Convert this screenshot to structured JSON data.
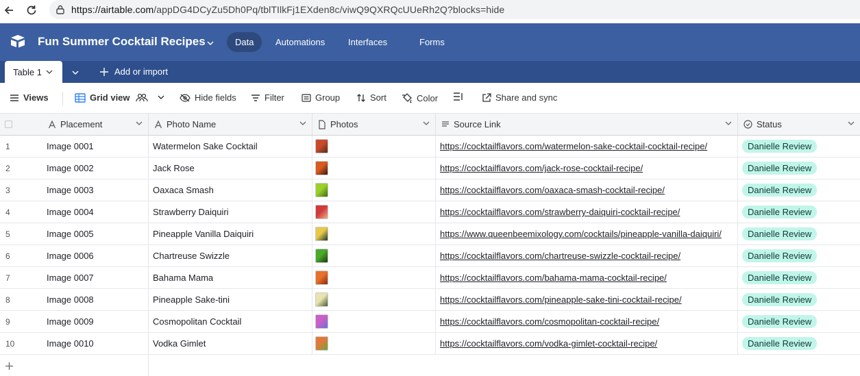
{
  "browser": {
    "url_host": "https://airtable.com",
    "url_path": "/appDG4DCyZu5Dh0Pq/tblTIlkFj1EXden8c/viwQ9QXRQcUUeRh2Q?blocks=hide"
  },
  "app": {
    "base_title": "Fun Summer Cocktail Recipes",
    "nav": [
      "Data",
      "Automations",
      "Interfaces",
      "Forms"
    ],
    "active_nav": "Data",
    "header_color": "#3b5fa0"
  },
  "tabs": {
    "active_table": "Table 1",
    "add_label": "Add or import"
  },
  "toolbar": {
    "views": "Views",
    "grid_view": "Grid view",
    "hide_fields": "Hide fields",
    "filter": "Filter",
    "group": "Group",
    "sort": "Sort",
    "color": "Color",
    "share": "Share and sync"
  },
  "columns": [
    {
      "label": "Placement",
      "icon": "text-field-icon"
    },
    {
      "label": "Photo Name",
      "icon": "text-field-icon"
    },
    {
      "label": "Photos",
      "icon": "attachment-icon"
    },
    {
      "label": "Source Link",
      "icon": "long-text-icon"
    },
    {
      "label": "Status",
      "icon": "status-icon"
    }
  ],
  "rows": [
    {
      "num": "1",
      "placement": "Image 0001",
      "name": "Watermelon Sake Cocktail",
      "link": "https://cocktailflavors.com/watermelon-sake-cocktail-cocktail-recipe/",
      "status": "Danielle Review",
      "thumb": [
        "#c94a2a",
        "#5a2a1a"
      ]
    },
    {
      "num": "2",
      "placement": "Image 0002",
      "name": "Jack Rose",
      "link": "https://cocktailflavors.com/jack-rose-cocktail-recipe/",
      "status": "Danielle Review",
      "thumb": [
        "#d85a20",
        "#3a1a10"
      ]
    },
    {
      "num": "3",
      "placement": "Image 0003",
      "name": "Oaxaca Smash",
      "link": "https://cocktailflavors.com/oaxaca-smash-cocktail-recipe/",
      "status": "Danielle Review",
      "thumb": [
        "#9bd12a",
        "#3f6a12"
      ]
    },
    {
      "num": "4",
      "placement": "Image 0004",
      "name": "Strawberry Daiquiri",
      "link": "https://cocktailflavors.com/strawberry-daiquiri-cocktail-recipe/",
      "status": "Danielle Review",
      "thumb": [
        "#d03a3a",
        "#f0b080"
      ]
    },
    {
      "num": "5",
      "placement": "Image 0005",
      "name": "Pineapple Vanilla Daiquiri",
      "link": "https://www.queenbeemixology.com/cocktails/pineapple-vanilla-daiquiri/",
      "status": "Danielle Review",
      "thumb": [
        "#e8c84a",
        "#1a3a2a"
      ]
    },
    {
      "num": "6",
      "placement": "Image 0006",
      "name": "Chartreuse Swizzle",
      "link": "https://cocktailflavors.com/chartreuse-swizzle-cocktail-recipe/",
      "status": "Danielle Review",
      "thumb": [
        "#4aa82a",
        "#1a3a12"
      ]
    },
    {
      "num": "7",
      "placement": "Image 0007",
      "name": "Bahama Mama",
      "link": "https://cocktailflavors.com/bahama-mama-cocktail-recipe/",
      "status": "Danielle Review",
      "thumb": [
        "#e8702a",
        "#8a2a10"
      ]
    },
    {
      "num": "8",
      "placement": "Image 0008",
      "name": "Pineapple Sake-tini",
      "link": "https://cocktailflavors.com/pineapple-sake-tini-cocktail-recipe/",
      "status": "Danielle Review",
      "thumb": [
        "#e8e4b0",
        "#4a5a3a"
      ]
    },
    {
      "num": "9",
      "placement": "Image 0009",
      "name": "Cosmopolitan Cocktail",
      "link": "https://cocktailflavors.com/cosmopolitan-cocktail-recipe/",
      "status": "Danielle Review",
      "thumb": [
        "#c860c8",
        "#6a70d8"
      ]
    },
    {
      "num": "10",
      "placement": "Image 0010",
      "name": "Vodka Gimlet",
      "link": "https://cocktailflavors.com/vodka-gimlet-cocktail-recipe/",
      "status": "Danielle Review",
      "thumb": [
        "#e07a3a",
        "#6aa83a"
      ]
    }
  ],
  "status_color": "#c2f5e9"
}
